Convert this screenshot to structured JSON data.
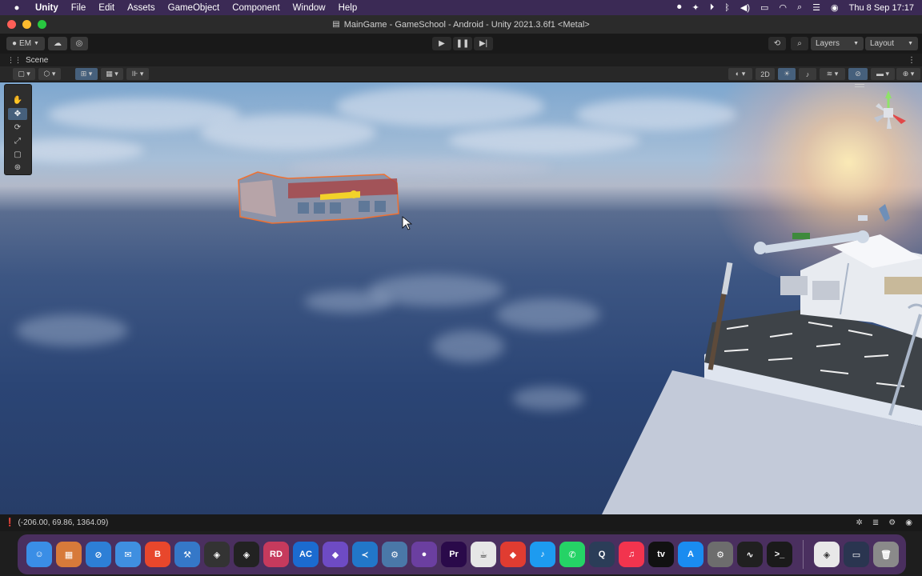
{
  "menubar": {
    "app": "Unity",
    "items": [
      "File",
      "Edit",
      "Assets",
      "GameObject",
      "Component",
      "Window",
      "Help"
    ],
    "datetime": "Thu 8 Sep  17:17",
    "status_icons": [
      "record-icon",
      "vpn-icon",
      "play-circle-icon",
      "bluetooth-icon",
      "volume-icon",
      "battery-icon",
      "wifi-icon",
      "search-icon",
      "control-center-icon",
      "siri-icon"
    ]
  },
  "window": {
    "title": "MainGame - GameSchool - Android - Unity 2021.3.6f1 <Metal>"
  },
  "toolbar": {
    "account": "EM",
    "layers_label": "Layers",
    "layout_label": "Layout"
  },
  "scene": {
    "tab_label": "Scene",
    "two_d_label": "2D"
  },
  "status": {
    "coordinates": "(-206.00, 69.86, 1364.09)"
  },
  "dock": {
    "apps": [
      {
        "name": "finder",
        "glyph": "☺",
        "color": "#3a8ee6"
      },
      {
        "name": "launchpad",
        "glyph": "▦",
        "color": "#d77a3a"
      },
      {
        "name": "safari",
        "glyph": "⊘",
        "color": "#2d7fd6"
      },
      {
        "name": "mail",
        "glyph": "✉",
        "color": "#3f8fe0"
      },
      {
        "name": "brave",
        "glyph": "B",
        "color": "#e8472c"
      },
      {
        "name": "xcode",
        "glyph": "⚒",
        "color": "#3578c8"
      },
      {
        "name": "unity-hub",
        "glyph": "◈",
        "color": "#333333"
      },
      {
        "name": "unity",
        "glyph": "◈",
        "color": "#222222"
      },
      {
        "name": "rider",
        "glyph": "RD",
        "color": "#c63a5d"
      },
      {
        "name": "appcode",
        "glyph": "AC",
        "color": "#1b6bd0"
      },
      {
        "name": "visual-studio",
        "glyph": "◆",
        "color": "#6e4bc4"
      },
      {
        "name": "vscode",
        "glyph": "≺",
        "color": "#2277c9"
      },
      {
        "name": "network-tool",
        "glyph": "⚙",
        "color": "#4a78a8"
      },
      {
        "name": "github-desktop",
        "glyph": "●",
        "color": "#6b3fa0"
      },
      {
        "name": "premiere",
        "glyph": "Pr",
        "color": "#2a0a4a"
      },
      {
        "name": "java",
        "glyph": "☕",
        "color": "#e6e6e6"
      },
      {
        "name": "anydesk",
        "glyph": "◆",
        "color": "#e03c31"
      },
      {
        "name": "twitter",
        "glyph": "♪",
        "color": "#1d9bf0"
      },
      {
        "name": "whatsapp",
        "glyph": "✆",
        "color": "#25d366"
      },
      {
        "name": "quicktime",
        "glyph": "Q",
        "color": "#2b3d58"
      },
      {
        "name": "music",
        "glyph": "♫",
        "color": "#f2344e"
      },
      {
        "name": "apple-tv",
        "glyph": "tv",
        "color": "#111111"
      },
      {
        "name": "app-store",
        "glyph": "A",
        "color": "#1a8cf0"
      },
      {
        "name": "system-preferences",
        "glyph": "⚙",
        "color": "#6d6d6d"
      },
      {
        "name": "activity-monitor",
        "glyph": "∿",
        "color": "#202020"
      },
      {
        "name": "terminal",
        "glyph": ">_",
        "color": "#1a1a1a"
      },
      {
        "name": "unity-running",
        "glyph": "◈",
        "color": "#e8e8e8"
      },
      {
        "name": "screen-recording",
        "glyph": "▭",
        "color": "#2a3550"
      },
      {
        "name": "trash",
        "glyph": "🗑",
        "color": "#8a8a8a"
      }
    ]
  }
}
